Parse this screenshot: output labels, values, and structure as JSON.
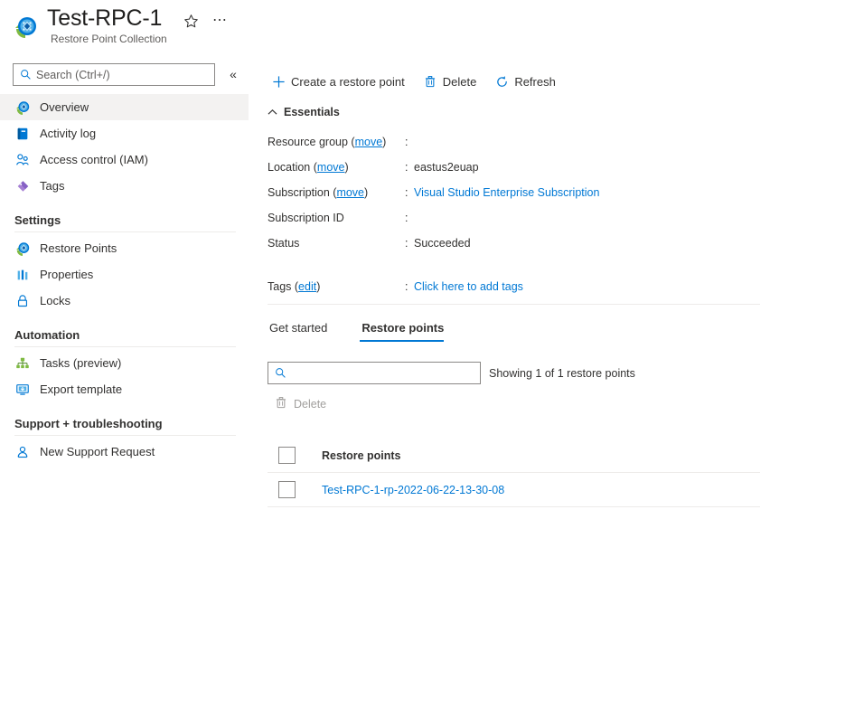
{
  "header": {
    "title": "Test-RPC-1",
    "subtitle": "Restore Point Collection",
    "resource_icon": "restore-point-collection-icon",
    "favorite_icon": "star-icon",
    "more_icon": "ellipsis-icon"
  },
  "sidebar": {
    "search": {
      "value": "",
      "placeholder": "Search (Ctrl+/)",
      "icon": "search-icon"
    },
    "collapse_icon": "chevron-double-left-icon",
    "items": [
      {
        "label": "Overview",
        "icon": "overview-icon",
        "selected": true
      },
      {
        "label": "Activity log",
        "icon": "activity-log-icon",
        "selected": false
      },
      {
        "label": "Access control (IAM)",
        "icon": "access-control-icon",
        "selected": false
      },
      {
        "label": "Tags",
        "icon": "tags-icon",
        "selected": false
      }
    ],
    "groups": [
      {
        "title": "Settings",
        "items": [
          {
            "label": "Restore Points",
            "icon": "restore-points-icon"
          },
          {
            "label": "Properties",
            "icon": "properties-icon"
          },
          {
            "label": "Locks",
            "icon": "lock-icon"
          }
        ]
      },
      {
        "title": "Automation",
        "items": [
          {
            "label": "Tasks (preview)",
            "icon": "tasks-icon"
          },
          {
            "label": "Export template",
            "icon": "export-template-icon"
          }
        ]
      },
      {
        "title": "Support + troubleshooting",
        "items": [
          {
            "label": "New Support Request",
            "icon": "support-request-icon"
          }
        ]
      }
    ]
  },
  "toolbar": {
    "create_label": "Create a restore point",
    "create_icon": "plus-icon",
    "delete_label": "Delete",
    "delete_icon": "trash-icon",
    "refresh_label": "Refresh",
    "refresh_icon": "refresh-icon"
  },
  "essentials": {
    "heading": "Essentials",
    "collapse_icon": "chevron-up-icon",
    "rows": [
      {
        "label": "Resource group",
        "link": "move",
        "suffix": ")",
        "colon": ":",
        "value": "",
        "is_link": false,
        "redacted": true
      },
      {
        "label": "Location",
        "link": "move",
        "suffix": ")",
        "colon": ":",
        "value": "eastus2euap",
        "is_link": false,
        "redacted": false
      },
      {
        "label": "Subscription",
        "link": "move",
        "suffix": ")",
        "colon": ":",
        "value": "Visual Studio Enterprise Subscription",
        "is_link": true,
        "redacted": false
      },
      {
        "label": "Subscription ID",
        "link": "",
        "suffix": "",
        "colon": ":",
        "value": "",
        "is_link": false,
        "redacted": true
      },
      {
        "label": "Status",
        "link": "",
        "suffix": "",
        "colon": ":",
        "value": "Succeeded",
        "is_link": false,
        "redacted": false
      }
    ],
    "tags_row": {
      "label": "Tags",
      "link": "edit",
      "suffix": ")",
      "colon": ":",
      "value": "Click here to add tags"
    }
  },
  "tabs": [
    {
      "label": "Get started",
      "active": false
    },
    {
      "label": "Restore points",
      "active": true
    }
  ],
  "restore_points_panel": {
    "filter": {
      "value": "",
      "placeholder": "",
      "icon": "search-icon"
    },
    "showing_text": "Showing 1 of 1 restore points",
    "grid_delete": {
      "label": "Delete",
      "icon": "trash-icon",
      "disabled": true
    },
    "column_header": "Restore points",
    "rows": [
      {
        "name": "Test-RPC-1-rp-2022-06-22-13-30-08"
      }
    ]
  },
  "colors": {
    "accent": "#0078d4",
    "link": "#0078d4",
    "text": "#323130",
    "muted": "#605e5c",
    "disabled": "#a19f9d",
    "divider": "#edebe9",
    "selected_bg": "#f3f2f1"
  }
}
